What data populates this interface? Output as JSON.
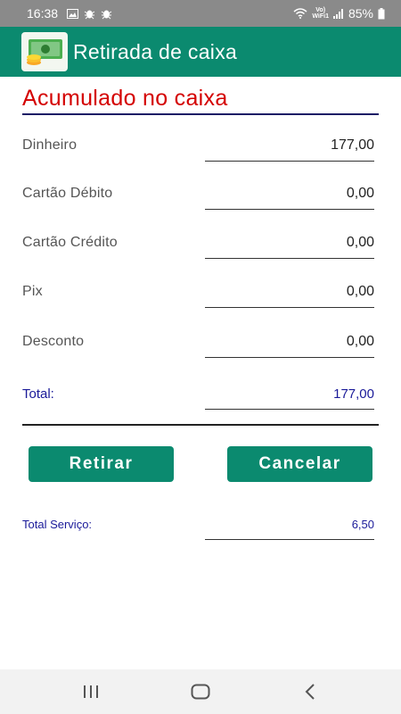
{
  "status_bar": {
    "time": "16:38",
    "battery": "85%",
    "volte_top": "Vo)",
    "volte_bottom": "WiFi1"
  },
  "app_bar": {
    "title": "Retirada de caixa",
    "icon": "money-icon"
  },
  "section": {
    "title": "Acumulado no caixa"
  },
  "rows": [
    {
      "label": "Dinheiro",
      "value": "177,00"
    },
    {
      "label": "Cartão Débito",
      "value": "0,00"
    },
    {
      "label": "Cartão Crédito",
      "value": "0,00"
    },
    {
      "label": "Pix",
      "value": "0,00"
    },
    {
      "label": "Desconto",
      "value": "0,00"
    }
  ],
  "total": {
    "label": "Total:",
    "value": "177,00"
  },
  "buttons": {
    "withdraw": "Retirar",
    "cancel": "Cancelar"
  },
  "service": {
    "label": "Total Serviço:",
    "value": "6,50"
  },
  "colors": {
    "primary": "#0b8a6f",
    "title_red": "#d40000",
    "total_blue": "#1a1a99"
  }
}
